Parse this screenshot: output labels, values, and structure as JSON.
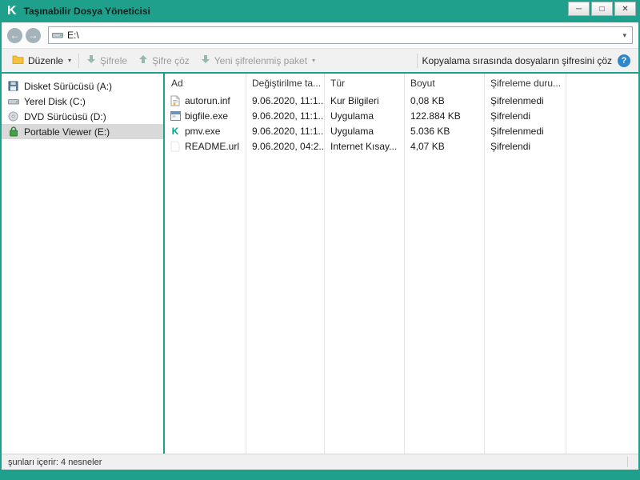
{
  "window": {
    "title": "Taşınabilir Dosya Yöneticisi",
    "logo_glyph": "K",
    "controls": {
      "minimize": "─",
      "maximize": "□",
      "close": "✕"
    }
  },
  "icons": {
    "arrow_left": "←",
    "arrow_right": "→",
    "caret_down": "▾",
    "info": "?"
  },
  "nav": {
    "address": "E:\\"
  },
  "toolbar": {
    "edit": "Düzenle",
    "encrypt": "Şifrele",
    "decrypt": "Şifre çöz",
    "new_package": "Yeni şifrelenmiş paket",
    "copy_decrypt_label": "Kopyalama sırasında dosyaların şifresini çöz"
  },
  "sidebar": {
    "items": [
      {
        "label": "Disket Sürücüsü (A:)",
        "icon": "floppy-icon",
        "selected": false
      },
      {
        "label": "Yerel Disk (C:)",
        "icon": "hard-drive-icon",
        "selected": false
      },
      {
        "label": "DVD Sürücüsü (D:)",
        "icon": "dvd-icon",
        "selected": false
      },
      {
        "label": "Portable Viewer (E:)",
        "icon": "lock-icon",
        "selected": true
      }
    ]
  },
  "filelist": {
    "columns": [
      "Ad",
      "Değiştirilme ta...",
      "Tür",
      "Boyut",
      "Şifreleme duru..."
    ],
    "rows": [
      {
        "name": "autorun.inf",
        "modified": "9.06.2020, 11:1...",
        "type": "Kur Bilgileri",
        "size": "0,08 KB",
        "status": "Şifrelenmedi",
        "icon": "inf-file-icon"
      },
      {
        "name": "bigfile.exe",
        "modified": "9.06.2020, 11:1...",
        "type": "Uygulama",
        "size": "122.884 KB",
        "status": "Şifrelendi",
        "icon": "exe-file-icon"
      },
      {
        "name": "pmv.exe",
        "modified": "9.06.2020, 11:1...",
        "type": "Uygulama",
        "size": "5.036 KB",
        "status": "Şifrelenmedi",
        "icon": "kaspersky-file-icon"
      },
      {
        "name": "README.url",
        "modified": "9.06.2020, 04:2...",
        "type": "Internet Kısay...",
        "size": "4,07 KB",
        "status": "Şifrelendi",
        "icon": "url-file-icon"
      }
    ]
  },
  "statusbar": {
    "text": "şunları içerir: 4 nesneler"
  },
  "colors": {
    "accent_teal": "#1fa08d",
    "info_blue": "#2f86c9",
    "selected_gray": "#d9d9d9"
  }
}
